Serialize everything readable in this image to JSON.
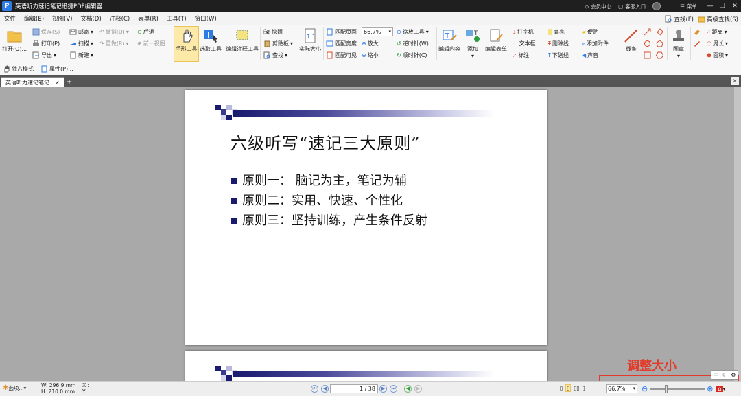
{
  "titlebar": {
    "logo": "P",
    "title": "英语听力速记笔记迅捷PDF编辑器",
    "member": "会员中心",
    "feedback": "客服入口",
    "menu": "菜单",
    "minimize": "—",
    "maximize": "❐",
    "close": "✕"
  },
  "menubar": {
    "items": [
      "文件",
      "编辑(E)",
      "视图(V)",
      "文档(D)",
      "注释(C)",
      "表单(R)",
      "工具(T)",
      "窗口(W)"
    ],
    "find": "查找(F)",
    "advanced_find": "高级查找(S)"
  },
  "ribbon": {
    "open": "打开(O)...",
    "save": "保存(S)",
    "print": "打印(P)...",
    "export": "导出",
    "email": "邮寄",
    "scan": "扫描",
    "new": "新建",
    "undo": "撤销(U)",
    "redo": "重做(R)",
    "back": "后退",
    "prev_view": "前一视图",
    "hand_tool": "手形工具",
    "select_tool": "选取工具",
    "annot_select": "编辑注释工具",
    "snapshot": "快照",
    "clipboard": "剪贴板",
    "find": "查找",
    "actual_size": "实际大小",
    "fit_page": "匹配页面",
    "fit_width": "匹配宽度",
    "fit_visible": "匹配可见",
    "zoom_value": "66.7%",
    "zoom_tool": "缩放工具",
    "zoom_in": "放大",
    "zoom_out": "缩小",
    "rotate_ccw": "逆时针(W)",
    "rotate_cw": "顺时针(C)",
    "edit_content": "编辑内容",
    "add": "添加",
    "edit_form": "编辑表单",
    "typewriter": "打字机",
    "textbox": "文本框",
    "callout": "标注",
    "highlight": "高亮",
    "strikeout": "删除线",
    "underline": "下划线",
    "note": "便贴",
    "attach": "添加附件",
    "sound": "声音",
    "line": "线条",
    "stamp": "图章",
    "distance": "距离",
    "perimeter": "周长",
    "area": "面积"
  },
  "subbar": {
    "exclusive_mode": "独占模式",
    "properties": "属性(P)..."
  },
  "tabs": {
    "doc_tab": "英语听力速记笔记",
    "close": "×",
    "add": "+",
    "close_all": "×"
  },
  "slide": {
    "title": "六级听写“速记三大原则”",
    "bullets": [
      "原则一： 脑记为主，笔记为辅",
      "原则二：实用、快速、个性化",
      "原则三：坚持训练，产生条件反射"
    ]
  },
  "status": {
    "options": "选项...",
    "width": "W: 296.9 mm",
    "height": "H: 210.0 mm",
    "x": "X :",
    "y": "Y :",
    "page_indicator": "1 / 38",
    "zoom": "66.7%"
  },
  "annotation": {
    "label": "调整大小"
  },
  "ime": {
    "label": "中"
  },
  "colors": {
    "accent": "#2d7be5",
    "annotation": "#e23b2a",
    "slide_navy": "#1a1a6e"
  }
}
